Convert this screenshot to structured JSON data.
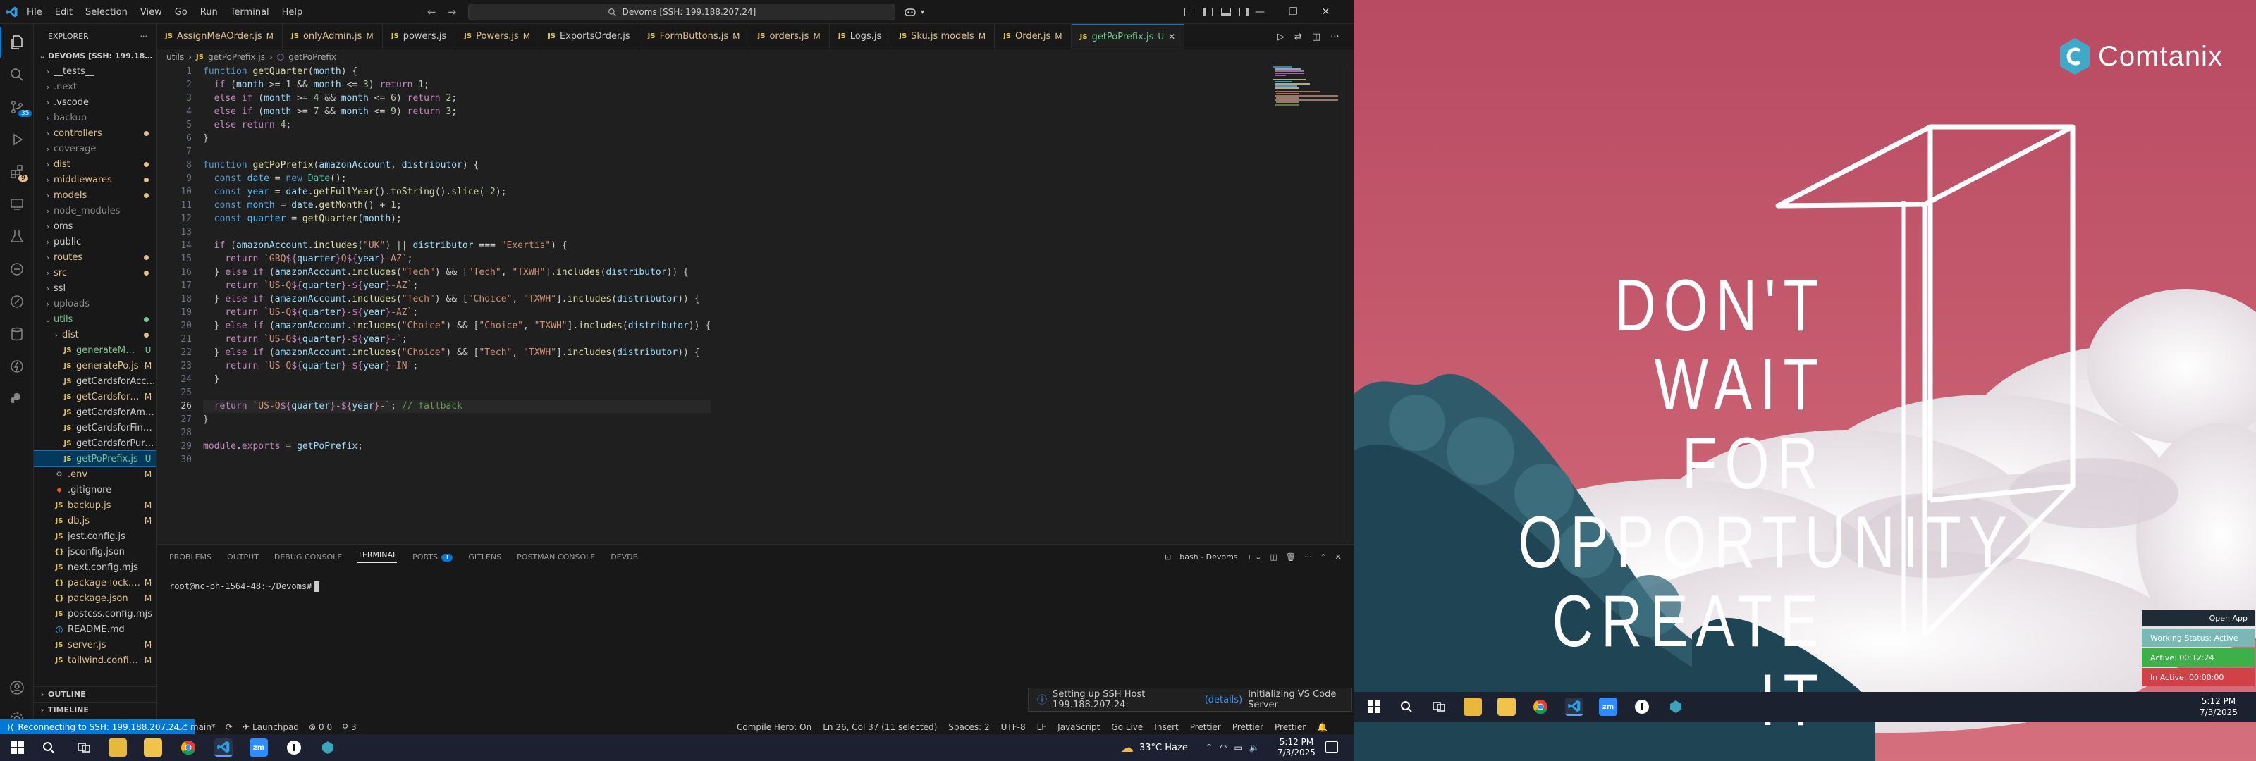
{
  "titlebar": {
    "menu": [
      "File",
      "Edit",
      "Selection",
      "View",
      "Go",
      "Run",
      "Terminal",
      "Help"
    ],
    "command_center": "Devoms [SSH: 199.188.207.24]"
  },
  "explorer": {
    "header": "EXPLORER",
    "root": "DEVOMS [SSH: 199.188.20...",
    "items": [
      {
        "name": "__tests__",
        "kind": "folder",
        "color": "#cccccc",
        "badge": "",
        "dot": ""
      },
      {
        "name": ".next",
        "kind": "folder",
        "color": "#8c8c8c",
        "badge": "",
        "dot": ""
      },
      {
        "name": ".vscode",
        "kind": "folder",
        "color": "#cccccc",
        "badge": "",
        "dot": ""
      },
      {
        "name": "backup",
        "kind": "folder",
        "color": "#8c8c8c",
        "badge": "",
        "dot": ""
      },
      {
        "name": "controllers",
        "kind": "folder",
        "color": "#e2c08d",
        "badge": "",
        "dot": "#e2c08d"
      },
      {
        "name": "coverage",
        "kind": "folder",
        "color": "#8c8c8c",
        "badge": "",
        "dot": ""
      },
      {
        "name": "dist",
        "kind": "folder",
        "color": "#e2c08d",
        "badge": "",
        "dot": "#e2c08d"
      },
      {
        "name": "middlewares",
        "kind": "folder",
        "color": "#e2c08d",
        "badge": "",
        "dot": "#e2c08d"
      },
      {
        "name": "models",
        "kind": "folder",
        "color": "#e2c08d",
        "badge": "",
        "dot": "#e2c08d"
      },
      {
        "name": "node_modules",
        "kind": "folder",
        "color": "#8c8c8c",
        "badge": "",
        "dot": ""
      },
      {
        "name": "oms",
        "kind": "folder",
        "color": "#cccccc",
        "badge": "",
        "dot": ""
      },
      {
        "name": "public",
        "kind": "folder",
        "color": "#cccccc",
        "badge": "",
        "dot": ""
      },
      {
        "name": "routes",
        "kind": "folder",
        "color": "#e2c08d",
        "badge": "",
        "dot": "#e2c08d"
      },
      {
        "name": "src",
        "kind": "folder",
        "color": "#e2c08d",
        "badge": "",
        "dot": "#e2c08d"
      },
      {
        "name": "ssl",
        "kind": "folder",
        "color": "#cccccc",
        "badge": "",
        "dot": ""
      },
      {
        "name": "uploads",
        "kind": "folder",
        "color": "#8c8c8c",
        "badge": "",
        "dot": ""
      },
      {
        "name": "utils",
        "kind": "folder-open",
        "color": "#73c991",
        "badge": "",
        "dot": "#73c991"
      },
      {
        "name": "dist",
        "kind": "folder-sub",
        "color": "#e2c08d",
        "badge": "",
        "dot": "#e2c08d"
      },
      {
        "name": "generateMulti...",
        "kind": "js-sub",
        "color": "#73c991",
        "badge": "U",
        "dot": ""
      },
      {
        "name": "generatePo.js",
        "kind": "js-sub",
        "color": "#e2c08d",
        "badge": "M",
        "dot": ""
      },
      {
        "name": "getCardsforAccount.js",
        "kind": "js-sub",
        "color": "#cccccc",
        "badge": "",
        "dot": ""
      },
      {
        "name": "getCardsforAd...",
        "kind": "js-sub",
        "color": "#e2c08d",
        "badge": "M",
        "dot": ""
      },
      {
        "name": "getCardsforAmazon.js",
        "kind": "js-sub",
        "color": "#cccccc",
        "badge": "",
        "dot": ""
      },
      {
        "name": "getCardsforFinance.js",
        "kind": "js-sub",
        "color": "#cccccc",
        "badge": "",
        "dot": ""
      },
      {
        "name": "getCardsforPurchasi...",
        "kind": "js-sub",
        "color": "#cccccc",
        "badge": "",
        "dot": ""
      },
      {
        "name": "getPoPrefix.js",
        "kind": "js-sub-sel",
        "color": "#73c991",
        "badge": "U",
        "dot": ""
      },
      {
        "name": ".env",
        "kind": "env",
        "color": "#e2c08d",
        "badge": "M",
        "dot": ""
      },
      {
        "name": ".gitignore",
        "kind": "git",
        "color": "#cccccc",
        "badge": "",
        "dot": ""
      },
      {
        "name": "backup.js",
        "kind": "js",
        "color": "#e2c08d",
        "badge": "M",
        "dot": ""
      },
      {
        "name": "db.js",
        "kind": "js",
        "color": "#e2c08d",
        "badge": "M",
        "dot": ""
      },
      {
        "name": "jest.config.js",
        "kind": "js",
        "color": "#cccccc",
        "badge": "",
        "dot": ""
      },
      {
        "name": "jsconfig.json",
        "kind": "json",
        "color": "#cccccc",
        "badge": "",
        "dot": ""
      },
      {
        "name": "next.config.mjs",
        "kind": "js",
        "color": "#cccccc",
        "badge": "",
        "dot": ""
      },
      {
        "name": "package-lock.json",
        "kind": "json",
        "color": "#e2c08d",
        "badge": "M",
        "dot": ""
      },
      {
        "name": "package.json",
        "kind": "json",
        "color": "#e2c08d",
        "badge": "M",
        "dot": ""
      },
      {
        "name": "postcss.config.mjs",
        "kind": "js",
        "color": "#cccccc",
        "badge": "",
        "dot": ""
      },
      {
        "name": "README.md",
        "kind": "md",
        "color": "#cccccc",
        "badge": "",
        "dot": ""
      },
      {
        "name": "server.js",
        "kind": "js",
        "color": "#e2c08d",
        "badge": "M",
        "dot": ""
      },
      {
        "name": "tailwind.config.js",
        "kind": "js",
        "color": "#e2c08d",
        "badge": "M",
        "dot": ""
      }
    ],
    "outline": "OUTLINE",
    "timeline": "TIMELINE"
  },
  "tabs": [
    {
      "label": "AssignMeAOrder.js",
      "mark": "M",
      "color": "#e2c08d",
      "active": false
    },
    {
      "label": "onlyAdmin.js",
      "mark": "M",
      "color": "#e2c08d",
      "active": false
    },
    {
      "label": "powers.js",
      "mark": "",
      "color": "#cccccc",
      "active": false
    },
    {
      "label": "Powers.js",
      "mark": "M",
      "color": "#e2c08d",
      "active": false
    },
    {
      "label": "ExportsOrder.js",
      "mark": "",
      "color": "#cccccc",
      "active": false
    },
    {
      "label": "FormButtons.js",
      "mark": "M",
      "color": "#e2c08d",
      "active": false
    },
    {
      "label": "orders.js",
      "mark": "M",
      "color": "#e2c08d",
      "active": false
    },
    {
      "label": "Logs.js",
      "mark": "",
      "color": "#cccccc",
      "active": false
    },
    {
      "label": "Sku.js models",
      "mark": "M",
      "color": "#e2c08d",
      "active": false
    },
    {
      "label": "Order.js",
      "mark": "M",
      "color": "#e2c08d",
      "active": false
    },
    {
      "label": "getPoPrefix.js",
      "mark": "U",
      "color": "#73c991",
      "active": true
    }
  ],
  "breadcrumb": [
    "utils",
    "getPoPrefix.js",
    "getPoPrefix"
  ],
  "code_lines": [
    "function getQuarter(month) {",
    "  if (month >= 1 && month <= 3) return 1;",
    "  else if (month >= 4 && month <= 6) return 2;",
    "  else if (month >= 7 && month <= 9) return 3;",
    "  else return 4;",
    "}",
    "",
    "function getPoPrefix(amazonAccount, distributor) {",
    "  const date = new Date();",
    "  const year = date.getFullYear().toString().slice(-2);",
    "  const month = date.getMonth() + 1;",
    "  const quarter = getQuarter(month);",
    "",
    "  if (amazonAccount.includes(\"UK\") || distributor === \"Exertis\") {",
    "    return `GBQ${quarter}Q${year}-AZ`;",
    "  } else if (amazonAccount.includes(\"Tech\") && [\"Tech\", \"TXWH\"].includes(distributor)) {",
    "    return `US-Q${quarter}-${year}-AZ`;",
    "  } else if (amazonAccount.includes(\"Tech\") && [\"Choice\", \"TXWH\"].includes(distributor)) {",
    "    return `US-Q${quarter}-${year}-AZ`;",
    "  } else if (amazonAccount.includes(\"Choice\") && [\"Choice\", \"TXWH\"].includes(distributor)) {",
    "    return `US-Q${quarter}-${year}-`;",
    "  } else if (amazonAccount.includes(\"Choice\") && [\"Tech\", \"TXWH\"].includes(distributor)) {",
    "    return `US-Q${quarter}-${year}-IN`;",
    "  }",
    "",
    "  return `US-Q${quarter}-${year}-`; // fallback",
    "}",
    "",
    "module.exports = getPoPrefix;",
    ""
  ],
  "panel": {
    "tabs": [
      "PROBLEMS",
      "OUTPUT",
      "DEBUG CONSOLE",
      "TERMINAL",
      "PORTS",
      "GITLENS",
      "POSTMAN CONSOLE",
      "DEVDB"
    ],
    "ports_badge": "1",
    "shell_label": "bash - Devoms",
    "prompt": "root@nc-ph-1564-48:~/Devoms#"
  },
  "toast": {
    "text": "Setting up SSH Host 199.188.207.24:",
    "link": "(details)",
    "suffix": "Initializing VS Code Server"
  },
  "statusbar": {
    "remote": "Reconnecting to SSH: 199.188.207.24...",
    "branch": "main*",
    "launchpad": "Launchpad",
    "problems": "0  0",
    "ports": "3",
    "compile_hero": "Compile Hero: On",
    "position": "Ln 26, Col 37 (11 selected)",
    "spaces": "Spaces: 2",
    "encoding": "UTF-8",
    "eol": "LF",
    "language": "JavaScript",
    "golive": "Go Live",
    "insert": "Insert",
    "prettier1": "Prettier",
    "prettier2": "Prettier",
    "prettier3": "Prettier"
  },
  "taskbar_left": {
    "weather": "33°C  Haze",
    "time": "5:12 PM",
    "date": "7/3/2025"
  },
  "desktop": {
    "brand": "Comtanix",
    "quote_lines": [
      "DON'T",
      "WAIT FOR",
      "OPPORTUNITY",
      "CREATE IT"
    ],
    "widget": {
      "open_app": "Open App",
      "status": "Working Status: Active",
      "active": "Active: 00:12:24",
      "inactive": "In Active: 00:00:00"
    },
    "time": "5:12 PM",
    "date": "7/3/2025"
  },
  "colors": {
    "accent": "#0078d4",
    "modified": "#e2c08d",
    "untracked": "#73c991",
    "desktop_bg": "#c25268"
  }
}
